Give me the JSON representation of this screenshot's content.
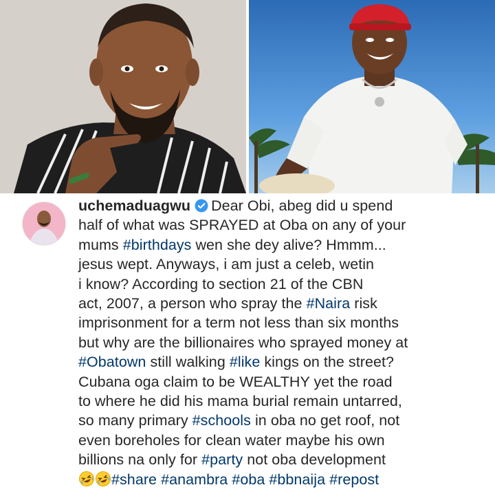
{
  "post": {
    "username": "uchemaduagwu",
    "verified_icon": "verified-badge-icon",
    "colors": {
      "text": "#262626",
      "hashtag": "#00376b",
      "verified": "#3897f0"
    },
    "lines": [
      [
        {
          "t": "text",
          "v": "Dear Obi, abeg did u spend"
        }
      ],
      [
        {
          "t": "text",
          "v": "half of what was SPRAYED at Oba on any of your"
        }
      ],
      [
        {
          "t": "text",
          "v": "mums "
        },
        {
          "t": "tag",
          "v": "#birthdays"
        },
        {
          "t": "text",
          "v": " wen she dey alive? Hmmm..."
        }
      ],
      [
        {
          "t": "text",
          "v": "jesus wept. Anyways, i am just a celeb, wetin"
        }
      ],
      [
        {
          "t": "text",
          "v": "i know? According to section 21 of the CBN"
        }
      ],
      [
        {
          "t": "text",
          "v": "act, 2007, a person who spray the "
        },
        {
          "t": "tag",
          "v": "#Naira"
        },
        {
          "t": "text",
          "v": " risk"
        }
      ],
      [
        {
          "t": "text",
          "v": "imprisonment for a term not less than six months"
        }
      ],
      [
        {
          "t": "text",
          "v": "but why are the billionaires who sprayed money at"
        }
      ],
      [
        {
          "t": "tag",
          "v": "#Obatown"
        },
        {
          "t": "text",
          "v": " still walking "
        },
        {
          "t": "tag",
          "v": "#like"
        },
        {
          "t": "text",
          "v": " kings on the street?"
        }
      ],
      [
        {
          "t": "text",
          "v": "Cubana oga claim to be WEALTHY yet the road"
        }
      ],
      [
        {
          "t": "text",
          "v": "to where he did his mama burial remain untarred,"
        }
      ],
      [
        {
          "t": "text",
          "v": "so many primary "
        },
        {
          "t": "tag",
          "v": "#schools"
        },
        {
          "t": "text",
          "v": " in oba no get roof, not"
        }
      ],
      [
        {
          "t": "text",
          "v": "even boreholes for clean water maybe his own"
        }
      ],
      [
        {
          "t": "text",
          "v": "billions na only for "
        },
        {
          "t": "tag",
          "v": "#party"
        },
        {
          "t": "text",
          "v": " not oba development"
        }
      ],
      [
        {
          "t": "emoji",
          "v": "rofl-emoji"
        },
        {
          "t": "emoji",
          "v": "rofl-emoji"
        },
        {
          "t": "tag",
          "v": "#share"
        },
        {
          "t": "text",
          "v": " "
        },
        {
          "t": "tag",
          "v": "#anambra"
        },
        {
          "t": "text",
          "v": " "
        },
        {
          "t": "tag",
          "v": "#oba"
        },
        {
          "t": "text",
          "v": " "
        },
        {
          "t": "tag",
          "v": "#bbnaija"
        },
        {
          "t": "text",
          "v": " "
        },
        {
          "t": "tag",
          "v": "#repost"
        }
      ]
    ]
  },
  "photos": {
    "left": "man-portrait-photo",
    "right": "man-in-red-cap-photo"
  }
}
